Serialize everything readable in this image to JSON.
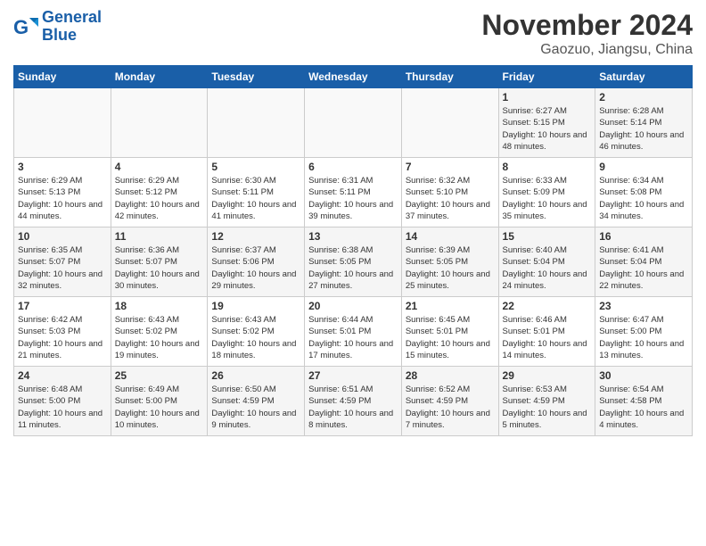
{
  "header": {
    "logo_line1": "General",
    "logo_line2": "Blue",
    "month_title": "November 2024",
    "location": "Gaozuo, Jiangsu, China"
  },
  "weekdays": [
    "Sunday",
    "Monday",
    "Tuesday",
    "Wednesday",
    "Thursday",
    "Friday",
    "Saturday"
  ],
  "weeks": [
    [
      {
        "day": "",
        "info": ""
      },
      {
        "day": "",
        "info": ""
      },
      {
        "day": "",
        "info": ""
      },
      {
        "day": "",
        "info": ""
      },
      {
        "day": "",
        "info": ""
      },
      {
        "day": "1",
        "info": "Sunrise: 6:27 AM\nSunset: 5:15 PM\nDaylight: 10 hours and 48 minutes."
      },
      {
        "day": "2",
        "info": "Sunrise: 6:28 AM\nSunset: 5:14 PM\nDaylight: 10 hours and 46 minutes."
      }
    ],
    [
      {
        "day": "3",
        "info": "Sunrise: 6:29 AM\nSunset: 5:13 PM\nDaylight: 10 hours and 44 minutes."
      },
      {
        "day": "4",
        "info": "Sunrise: 6:29 AM\nSunset: 5:12 PM\nDaylight: 10 hours and 42 minutes."
      },
      {
        "day": "5",
        "info": "Sunrise: 6:30 AM\nSunset: 5:11 PM\nDaylight: 10 hours and 41 minutes."
      },
      {
        "day": "6",
        "info": "Sunrise: 6:31 AM\nSunset: 5:11 PM\nDaylight: 10 hours and 39 minutes."
      },
      {
        "day": "7",
        "info": "Sunrise: 6:32 AM\nSunset: 5:10 PM\nDaylight: 10 hours and 37 minutes."
      },
      {
        "day": "8",
        "info": "Sunrise: 6:33 AM\nSunset: 5:09 PM\nDaylight: 10 hours and 35 minutes."
      },
      {
        "day": "9",
        "info": "Sunrise: 6:34 AM\nSunset: 5:08 PM\nDaylight: 10 hours and 34 minutes."
      }
    ],
    [
      {
        "day": "10",
        "info": "Sunrise: 6:35 AM\nSunset: 5:07 PM\nDaylight: 10 hours and 32 minutes."
      },
      {
        "day": "11",
        "info": "Sunrise: 6:36 AM\nSunset: 5:07 PM\nDaylight: 10 hours and 30 minutes."
      },
      {
        "day": "12",
        "info": "Sunrise: 6:37 AM\nSunset: 5:06 PM\nDaylight: 10 hours and 29 minutes."
      },
      {
        "day": "13",
        "info": "Sunrise: 6:38 AM\nSunset: 5:05 PM\nDaylight: 10 hours and 27 minutes."
      },
      {
        "day": "14",
        "info": "Sunrise: 6:39 AM\nSunset: 5:05 PM\nDaylight: 10 hours and 25 minutes."
      },
      {
        "day": "15",
        "info": "Sunrise: 6:40 AM\nSunset: 5:04 PM\nDaylight: 10 hours and 24 minutes."
      },
      {
        "day": "16",
        "info": "Sunrise: 6:41 AM\nSunset: 5:04 PM\nDaylight: 10 hours and 22 minutes."
      }
    ],
    [
      {
        "day": "17",
        "info": "Sunrise: 6:42 AM\nSunset: 5:03 PM\nDaylight: 10 hours and 21 minutes."
      },
      {
        "day": "18",
        "info": "Sunrise: 6:43 AM\nSunset: 5:02 PM\nDaylight: 10 hours and 19 minutes."
      },
      {
        "day": "19",
        "info": "Sunrise: 6:43 AM\nSunset: 5:02 PM\nDaylight: 10 hours and 18 minutes."
      },
      {
        "day": "20",
        "info": "Sunrise: 6:44 AM\nSunset: 5:01 PM\nDaylight: 10 hours and 17 minutes."
      },
      {
        "day": "21",
        "info": "Sunrise: 6:45 AM\nSunset: 5:01 PM\nDaylight: 10 hours and 15 minutes."
      },
      {
        "day": "22",
        "info": "Sunrise: 6:46 AM\nSunset: 5:01 PM\nDaylight: 10 hours and 14 minutes."
      },
      {
        "day": "23",
        "info": "Sunrise: 6:47 AM\nSunset: 5:00 PM\nDaylight: 10 hours and 13 minutes."
      }
    ],
    [
      {
        "day": "24",
        "info": "Sunrise: 6:48 AM\nSunset: 5:00 PM\nDaylight: 10 hours and 11 minutes."
      },
      {
        "day": "25",
        "info": "Sunrise: 6:49 AM\nSunset: 5:00 PM\nDaylight: 10 hours and 10 minutes."
      },
      {
        "day": "26",
        "info": "Sunrise: 6:50 AM\nSunset: 4:59 PM\nDaylight: 10 hours and 9 minutes."
      },
      {
        "day": "27",
        "info": "Sunrise: 6:51 AM\nSunset: 4:59 PM\nDaylight: 10 hours and 8 minutes."
      },
      {
        "day": "28",
        "info": "Sunrise: 6:52 AM\nSunset: 4:59 PM\nDaylight: 10 hours and 7 minutes."
      },
      {
        "day": "29",
        "info": "Sunrise: 6:53 AM\nSunset: 4:59 PM\nDaylight: 10 hours and 5 minutes."
      },
      {
        "day": "30",
        "info": "Sunrise: 6:54 AM\nSunset: 4:58 PM\nDaylight: 10 hours and 4 minutes."
      }
    ]
  ]
}
